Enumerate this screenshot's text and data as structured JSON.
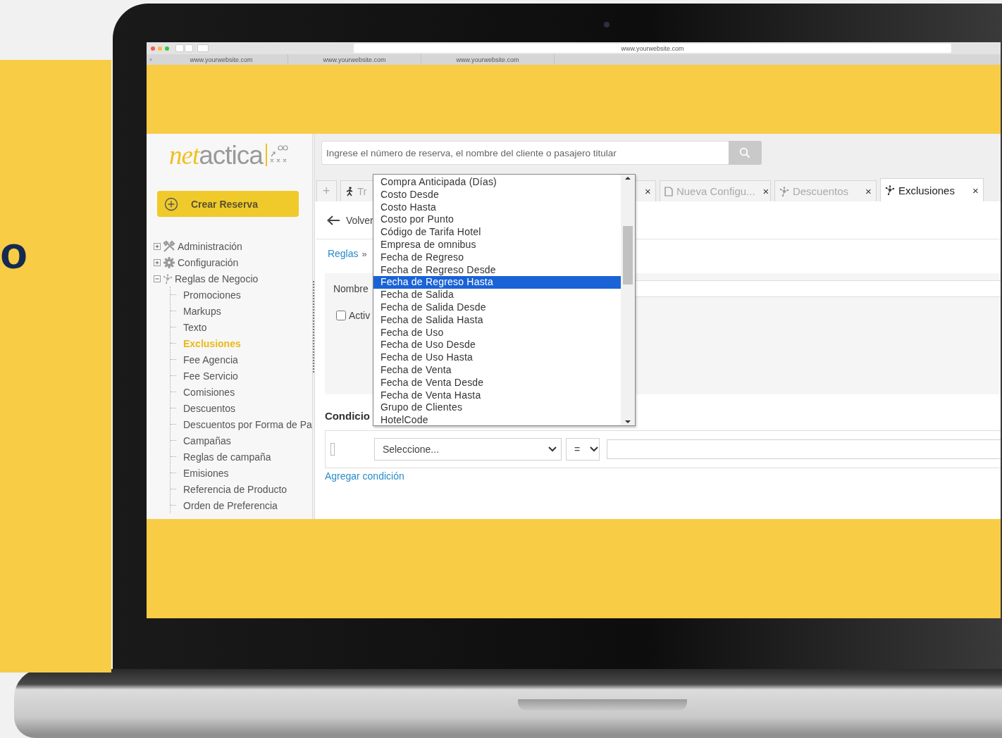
{
  "promo": {
    "heading": "o"
  },
  "browser": {
    "address": "www.yourwebsite.com",
    "close": "×",
    "tabs": [
      {
        "label": "www.yourwebsite.com"
      },
      {
        "label": "www.yourwebsite.com"
      },
      {
        "label": "www.yourwebsite.com"
      }
    ]
  },
  "sidebar": {
    "logo": {
      "accent": "net",
      "rest": "actica"
    },
    "create_button": "Crear Reserva",
    "tree": [
      {
        "label": "Administración",
        "expanded": false
      },
      {
        "label": "Configuración",
        "expanded": false
      },
      {
        "label": "Reglas de Negocio",
        "expanded": true,
        "children": [
          {
            "label": "Promociones",
            "selected": false
          },
          {
            "label": "Markups",
            "selected": false
          },
          {
            "label": "Texto",
            "selected": false
          },
          {
            "label": "Exclusiones",
            "selected": true
          },
          {
            "label": "Fee Agencia",
            "selected": false
          },
          {
            "label": "Fee Servicio",
            "selected": false
          },
          {
            "label": "Comisiones",
            "selected": false
          },
          {
            "label": "Descuentos",
            "selected": false
          },
          {
            "label": "Descuentos por Forma de Pa",
            "selected": false
          },
          {
            "label": "Campañas",
            "selected": false
          },
          {
            "label": "Reglas de campaña",
            "selected": false
          },
          {
            "label": "Emisiones",
            "selected": false
          },
          {
            "label": "Referencia de Producto",
            "selected": false
          },
          {
            "label": "Orden de Preferencia",
            "selected": false
          }
        ]
      }
    ]
  },
  "search": {
    "placeholder": "Ingrese el número de reserva, el nombre del cliente o pasajero titular"
  },
  "tabs": [
    {
      "kind": "add",
      "label": "+",
      "selected": false
    },
    {
      "kind": "person",
      "label": "Tr",
      "close": "×",
      "selected": false
    },
    {
      "kind": "page",
      "label": "Nueva Configu...",
      "close": "×",
      "selected": false
    },
    {
      "kind": "rules",
      "label": "Descuentos",
      "close": "×",
      "selected": false
    },
    {
      "kind": "rules",
      "label": "Exclusiones",
      "close": "×",
      "selected": true
    }
  ],
  "back": "Volver",
  "breadcrumb": {
    "link": "Reglas",
    "separator": "»"
  },
  "form": {
    "name_label": "Nombre",
    "active": {
      "label": "Activ",
      "checked": false
    }
  },
  "conditions": {
    "title": "Condicio",
    "rows": [
      {
        "field": "Seleccione...",
        "operator": "="
      }
    ],
    "add_link": "Agregar condición"
  },
  "dropdown": {
    "options": [
      {
        "label": "Compra Anticipada (Días)",
        "selected": false
      },
      {
        "label": "Costo Desde",
        "selected": false
      },
      {
        "label": "Costo Hasta",
        "selected": false
      },
      {
        "label": "Costo por Punto",
        "selected": false
      },
      {
        "label": "Código de Tarifa Hotel",
        "selected": false
      },
      {
        "label": "Empresa de omnibus",
        "selected": false
      },
      {
        "label": "Fecha de Regreso",
        "selected": false
      },
      {
        "label": "Fecha de Regreso Desde",
        "selected": false
      },
      {
        "label": "Fecha de Regreso Hasta",
        "selected": true
      },
      {
        "label": "Fecha de Salida",
        "selected": false
      },
      {
        "label": "Fecha de Salida Desde",
        "selected": false
      },
      {
        "label": "Fecha de Salida Hasta",
        "selected": false
      },
      {
        "label": "Fecha de Uso",
        "selected": false
      },
      {
        "label": "Fecha de Uso Desde",
        "selected": false
      },
      {
        "label": "Fecha de Uso Hasta",
        "selected": false
      },
      {
        "label": "Fecha de Venta",
        "selected": false
      },
      {
        "label": "Fecha de Venta Desde",
        "selected": false
      },
      {
        "label": "Fecha de Venta Hasta",
        "selected": false
      },
      {
        "label": "Grupo de Clientes",
        "selected": false
      },
      {
        "label": "HotelCode",
        "selected": false
      }
    ]
  }
}
